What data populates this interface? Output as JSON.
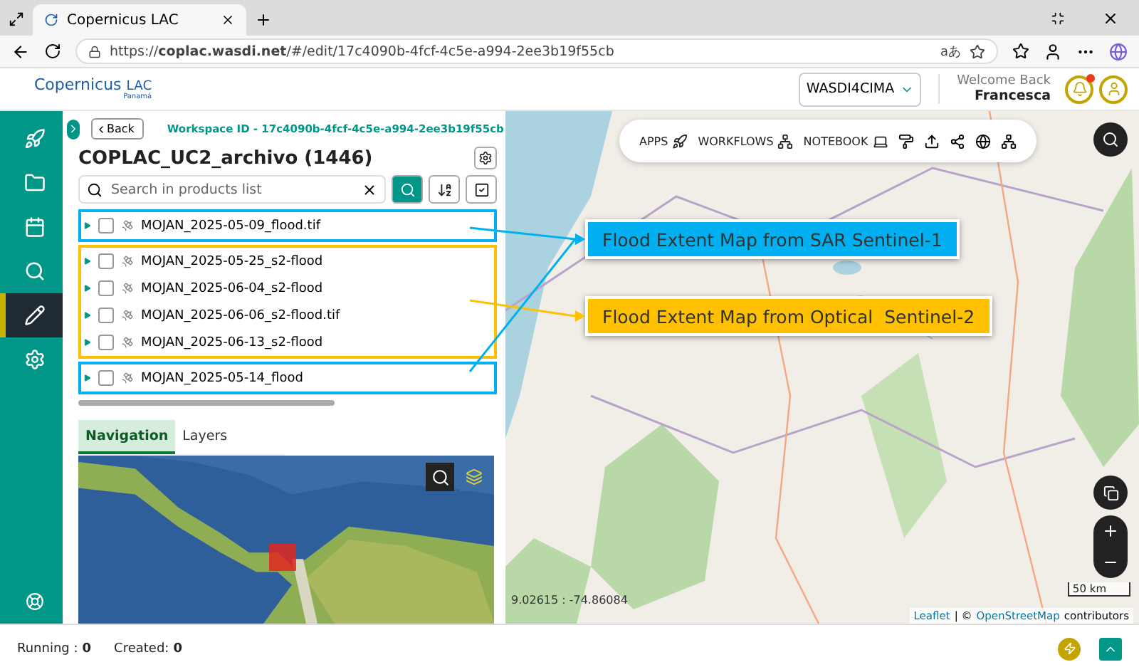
{
  "browser": {
    "tab_title": "Copernicus LAC",
    "url": "https://**coplac.wasdi.net**/#/edit/17c4090b-4fcf-4c5e-a994-2ee3b19f55cb",
    "translate_glyph": "aあ"
  },
  "header": {
    "logo": {
      "name": "Copernicus",
      "suffix": "LAC",
      "region": "Panamá"
    },
    "workspace_select": "WASDI4CIMA",
    "welcome": "Welcome Back",
    "user": "Francesca",
    "notification_unread": true
  },
  "sidebar": {
    "items": [
      {
        "selected": false
      },
      {
        "selected": false
      },
      {
        "selected": false
      },
      {
        "selected": false
      },
      {
        "selected": true
      },
      {
        "selected": false
      }
    ]
  },
  "panel": {
    "back": "Back",
    "workspace_id": "Workspace ID - 17c4090b-4fcf-4c5e-a994-2ee3b19f55cb",
    "title": "COPLAC_UC2_archivo (1446)",
    "search": {
      "placeholder": "Search in products list"
    },
    "product_groups": [
      {
        "color": "#00b0f0",
        "items": [
          {
            "name": "MOJAN_2025-05-09_flood.tif",
            "checked": false
          }
        ]
      },
      {
        "color": "#ffc000",
        "items": [
          {
            "name": "MOJAN_2025-05-25_s2-flood",
            "checked": false
          },
          {
            "name": "MOJAN_2025-06-04_s2-flood",
            "checked": false
          },
          {
            "name": "MOJAN_2025-06-06_s2-flood.tif",
            "checked": false
          },
          {
            "name": "MOJAN_2025-06-13_s2-flood",
            "checked": false
          }
        ]
      },
      {
        "color": "#00b0f0",
        "items": [
          {
            "name": "MOJAN_2025-05-14_flood",
            "checked": false
          }
        ]
      }
    ],
    "tabs": [
      {
        "label": "Navigation",
        "selected": true
      },
      {
        "label": "Layers",
        "selected": false
      }
    ]
  },
  "map": {
    "toolbar": [
      "APPS",
      "WORKFLOWS",
      "NOTEBOOK"
    ],
    "coordinates": "9.02615 : -74.86084",
    "scale": "50 km",
    "attribution": {
      "leaflet": "Leaflet",
      "separator": "| ©",
      "osm": "OpenStreetMap",
      "rest": "contributors"
    },
    "callouts": [
      {
        "label": "Flood Extent Map from SAR Sentinel-1",
        "color": "#00b0f0"
      },
      {
        "label": "Flood Extent Map from Optical  Sentinel-2",
        "color": "#ffc000"
      }
    ]
  },
  "footer": {
    "running_label": "Running :",
    "running": "0",
    "created_label": "Created:",
    "created": "0"
  }
}
